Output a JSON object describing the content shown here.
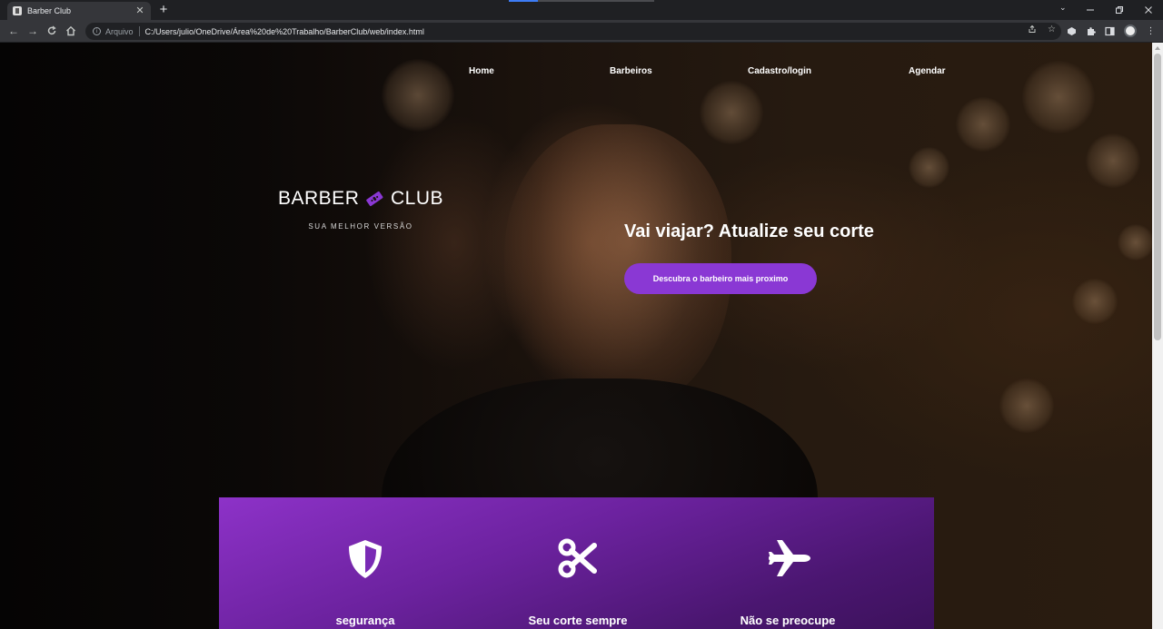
{
  "browser": {
    "tab_title": "Barber Club",
    "tab_close": "✕",
    "new_tab": "+",
    "scheme_label": "Arquivo",
    "url": "C:/Users/julio/OneDrive/Área%20de%20Trabalho/BarberClub/web/index.html",
    "icons": [
      "back-icon",
      "forward-icon",
      "reload-icon",
      "home-icon",
      "info-icon",
      "share-icon",
      "bookmark-star-icon",
      "extension-icon",
      "puzzle-icon",
      "sidepanel-icon",
      "profile-avatar",
      "menu-icon"
    ]
  },
  "nav": {
    "home": "Home",
    "barbers": "Barbeiros",
    "signup": "Cadastro/login",
    "schedule": "Agendar"
  },
  "logo": {
    "left": "BARBER",
    "right": "CLUB",
    "tagline": "SUA MELHOR VERSÃO",
    "accent": "#8a38d4"
  },
  "hero": {
    "headline": "Vai viajar? Atualize seu corte",
    "cta": "Descubra o barbeiro mais proximo",
    "cta_color": "#8a38d4"
  },
  "features": [
    {
      "icon": "shield-icon",
      "label": "segurança"
    },
    {
      "icon": "scissors-icon",
      "label": "Seu corte sempre"
    },
    {
      "icon": "airplane-icon",
      "label": "Não se preocupe"
    }
  ]
}
